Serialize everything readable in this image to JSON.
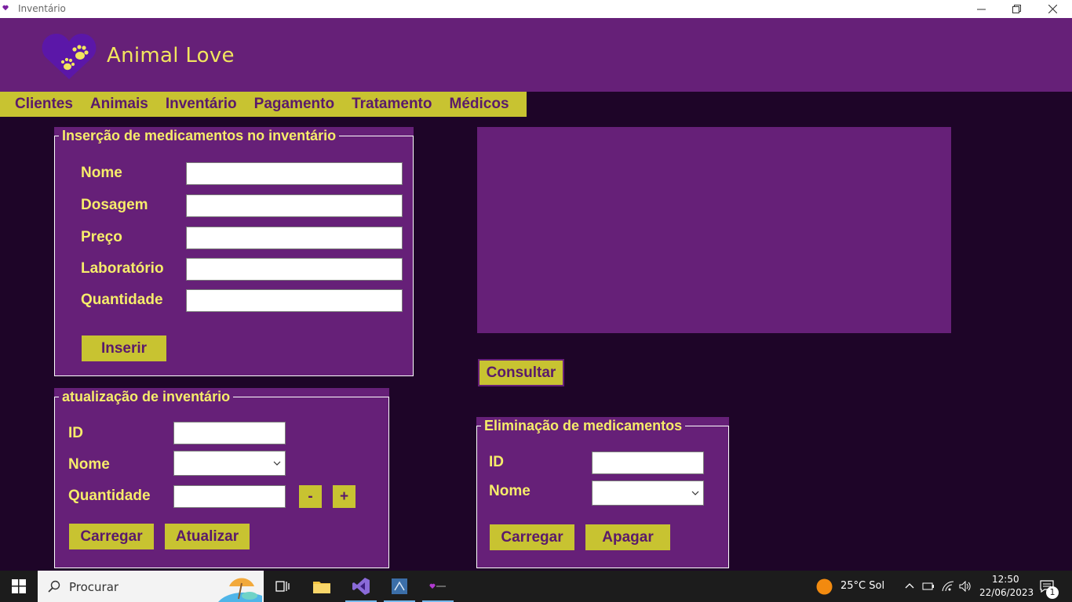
{
  "window": {
    "title": "Inventário"
  },
  "header": {
    "brand": "Animal Love"
  },
  "menu": [
    "Clientes",
    "Animais",
    "Inventário",
    "Pagamento",
    "Tratamento",
    "Médicos"
  ],
  "insert_panel": {
    "legend": "Inserção de medicamentos no inventário",
    "fields": [
      {
        "label": "Nome",
        "value": ""
      },
      {
        "label": "Dosagem",
        "value": ""
      },
      {
        "label": "Preço",
        "value": ""
      },
      {
        "label": "Laboratório",
        "value": ""
      },
      {
        "label": "Quantidade",
        "value": ""
      }
    ],
    "button": "Inserir"
  },
  "update_panel": {
    "legend": "atualização de inventário",
    "id_label": "ID",
    "nome_label": "Nome",
    "quantidade_label": "Quantidade",
    "minus": "-",
    "plus": "+",
    "load_button": "Carregar",
    "update_button": "Atualizar"
  },
  "consult_button": "Consultar",
  "delete_panel": {
    "legend": "Eliminação de medicamentos",
    "id_label": "ID",
    "nome_label": "Nome",
    "load_button": "Carregar",
    "delete_button": "Apagar"
  },
  "taskbar": {
    "search_placeholder": "Procurar",
    "weather": "25°C  Sol",
    "time": "12:50",
    "date": "22/06/2023",
    "notifications": "1"
  },
  "colors": {
    "header": "#662078",
    "background": "#1e0528",
    "accent": "#c8c331",
    "label": "#f6ec6a"
  }
}
